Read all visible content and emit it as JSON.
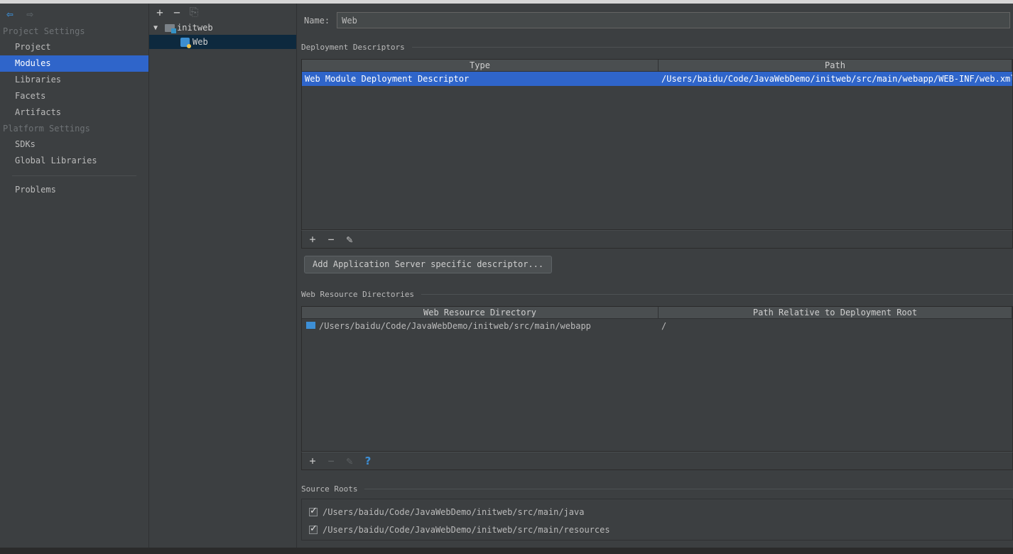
{
  "nav": {
    "sections": [
      {
        "title": "Project Settings",
        "items": [
          "Project",
          "Modules",
          "Libraries",
          "Facets",
          "Artifacts"
        ]
      },
      {
        "title": "Platform Settings",
        "items": [
          "SDKs",
          "Global Libraries"
        ]
      }
    ],
    "problems": "Problems",
    "selected": "Modules"
  },
  "toolbar": {
    "add": "+",
    "remove": "−",
    "copy": "⎘",
    "back": "⇦",
    "forward": "⇨"
  },
  "tree": {
    "module": "initweb",
    "facet": "Web",
    "arrow": "▼"
  },
  "name": {
    "label": "Name:",
    "value": "Web"
  },
  "deployment": {
    "title": "Deployment Descriptors",
    "columns": [
      "Type",
      "Path"
    ],
    "rows": [
      {
        "type": "Web Module Deployment Descriptor",
        "path": "/Users/baidu/Code/JavaWebDemo/initweb/src/main/webapp/WEB-INF/web.xml"
      }
    ],
    "add_server_button": "Add Application Server specific descriptor..."
  },
  "resources": {
    "title": "Web Resource Directories",
    "columns": [
      "Web Resource Directory",
      "Path Relative to Deployment Root"
    ],
    "rows": [
      {
        "dir": "/Users/baidu/Code/JavaWebDemo/initweb/src/main/webapp",
        "rel": "/"
      }
    ]
  },
  "table_toolbar": {
    "add": "+",
    "remove": "−",
    "edit": "✎",
    "help": "?"
  },
  "source_roots": {
    "title": "Source Roots",
    "items": [
      "/Users/baidu/Code/JavaWebDemo/initweb/src/main/java",
      "/Users/baidu/Code/JavaWebDemo/initweb/src/main/resources"
    ]
  },
  "colors": {
    "selection": "#2f65ca",
    "background": "#3c3f41",
    "accent": "#3d8fd6"
  }
}
